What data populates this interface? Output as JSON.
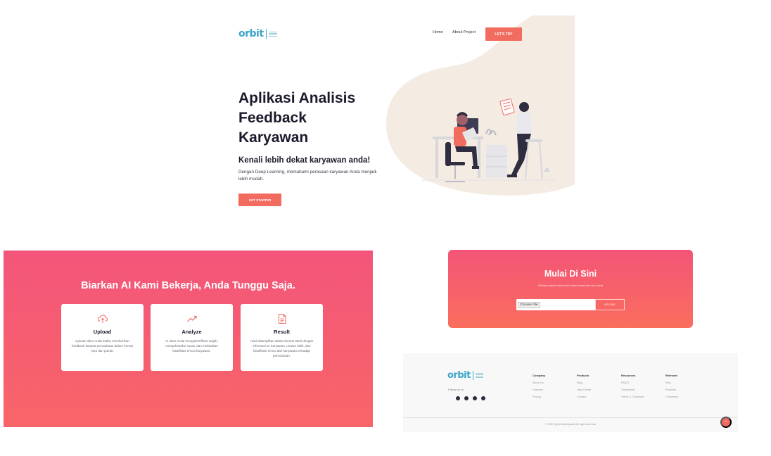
{
  "hero": {
    "logo_text": "orbit",
    "nav": {
      "home": "Home",
      "about": "About Project",
      "try": "LET'S TRY"
    },
    "title": "Aplikasi Analisis Feedback Karyawan",
    "subtitle": "Kenali lebih dekat karyawan anda!",
    "description": "Dengan Deep Learning, memahami perasaan karyawan Anda menjadi lebih mudah.",
    "cta": "GET STARTED"
  },
  "features": {
    "title": "Biarkan AI Kami Bekerja, Anda Tunggu Saja.",
    "cards": [
      {
        "icon": "cloud-upload-icon",
        "title": "Upload",
        "text": "Upload video Anda ketika memberikan feedback kepada perusahaan dalam format mp4 dan potrait."
      },
      {
        "icon": "trend-line-icon",
        "title": "Analyze",
        "text": "AI akan mulai mengidentifikasi wajah, mengekstraksi suara, dan melakukan klasifikasi emosi karyawan."
      },
      {
        "icon": "document-icon",
        "title": "Result",
        "text": "Hasil ditampilkan dalam bentuk tabel dengan informasi ID Karyawan, umpan balik, dan klasifikasi emosi dari karyawan terhadap perusahaan."
      }
    ]
  },
  "start": {
    "title": "Mulai Di Sini",
    "description": "Silahkan upload video Anda dalam format mp4 dan potrait",
    "file_button": "Choose File",
    "upload": "UPLOAD"
  },
  "footer": {
    "logo_text": "orbit",
    "follow": "Follow us on",
    "social_icons": [
      "github-icon",
      "instagram-icon",
      "youtube-icon",
      "facebook-icon"
    ],
    "columns": [
      {
        "head": "Company",
        "links": [
          "About Us",
          "Features",
          "Pricing"
        ]
      },
      {
        "head": "Products",
        "links": [
          "Blog",
          "Help Center",
          "Contact"
        ]
      },
      {
        "head": "Resources",
        "links": [
          "FAQ'S",
          "Testimonial",
          "Terms & Conditions"
        ]
      },
      {
        "head": "Relevent",
        "links": [
          "Why",
          "Products",
          "Customers"
        ]
      }
    ],
    "copyright": "© 2022 @defrisandyawib All right reserved"
  },
  "colors": {
    "accent": "#f26b5f",
    "gradient_top": "#f3557a",
    "gradient_bottom": "#f86568",
    "logo": "#3aa6c9"
  }
}
